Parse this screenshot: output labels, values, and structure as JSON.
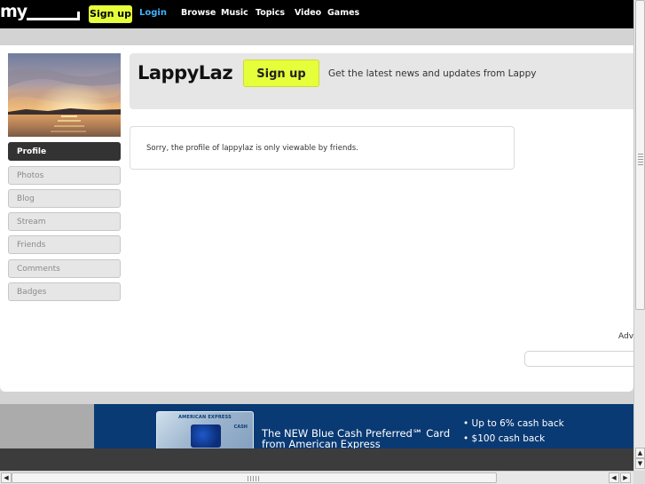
{
  "topbar": {
    "logo": "my",
    "signup_label": "Sign up",
    "login_label": "Login",
    "nav": [
      "Browse",
      "Music",
      "Topics",
      "Video",
      "Games"
    ]
  },
  "profile": {
    "username": "LappyLaz",
    "signup_label": "Sign up",
    "tagline": "Get the latest news and updates from Lappy",
    "notice": "Sorry, the profile of lappylaz is only viewable by friends."
  },
  "sidebar": {
    "items": [
      {
        "label": "Profile",
        "active": true
      },
      {
        "label": "Photos"
      },
      {
        "label": "Blog"
      },
      {
        "label": "Stream"
      },
      {
        "label": "Friends"
      },
      {
        "label": "Comments"
      },
      {
        "label": "Badges"
      }
    ]
  },
  "ads": {
    "label": "Adv"
  },
  "banner": {
    "card_brand": "AMERICAN EXPRESS",
    "card_tag": "CASH",
    "title": "The NEW Blue Cash Preferred℠ Card",
    "subtitle": "from American Express",
    "bullets": [
      "• Up to 6% cash back",
      "• $100 cash back"
    ]
  },
  "colors": {
    "accent_yellow": "#e6ff3b",
    "login_blue": "#3fb3ff",
    "banner_navy": "#0a3a74"
  }
}
